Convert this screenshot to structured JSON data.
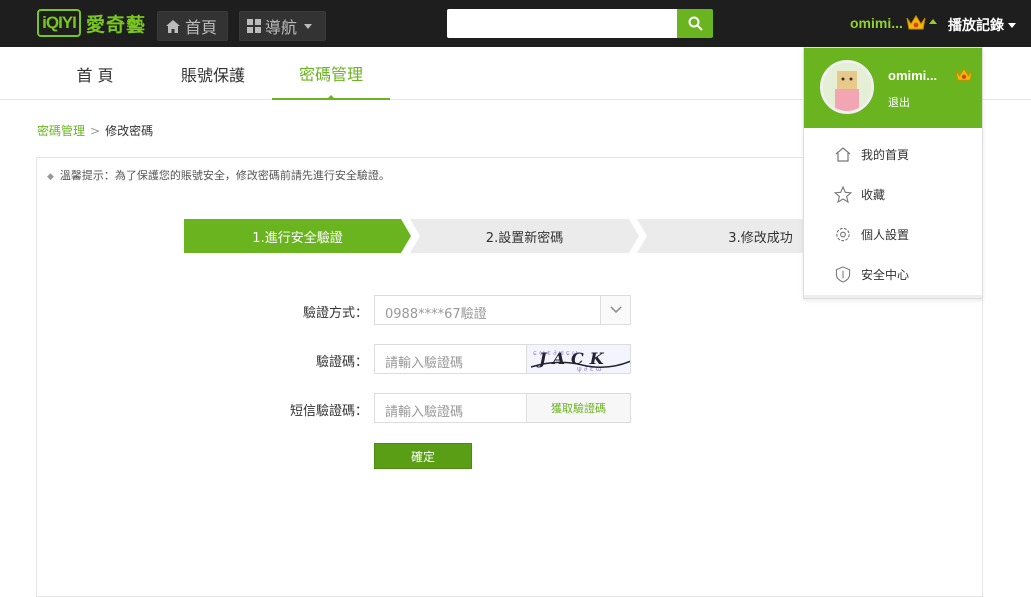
{
  "header": {
    "logo_mark": "iQIYI",
    "logo_text": "愛奇藝",
    "home_label": "首頁",
    "nav_label": "導航",
    "search_placeholder": "",
    "username": "omimi...",
    "history_label": "播放記錄",
    "accent_color": "#6ab41f"
  },
  "tabs": [
    {
      "label": "首 頁",
      "active": false
    },
    {
      "label": "賬號保護",
      "active": false
    },
    {
      "label": "密碼管理",
      "active": true
    }
  ],
  "breadcrumb": {
    "parent": "密碼管理",
    "separator": ">",
    "current": "修改密碼"
  },
  "tip": "溫馨提示：為了保護您的賬號安全，修改密碼前請先進行安全驗證。",
  "steps": [
    "1.進行安全驗證",
    "2.設置新密碼",
    "3.修改成功"
  ],
  "form": {
    "method_label": "驗證方式：",
    "method_value": "0988****67驗證",
    "captcha_label": "驗證碼：",
    "captcha_placeholder": "請輸入驗證碼",
    "captcha_text": "JACK",
    "sms_label": "短信驗證碼：",
    "sms_placeholder": "請輸入驗證碼",
    "sms_button": "獲取驗證碼",
    "submit": "確定"
  },
  "dropdown": {
    "name": "omimi...",
    "logout": "退出",
    "items": [
      {
        "label": "我的首頁",
        "icon": "home-icon"
      },
      {
        "label": "收藏",
        "icon": "star-icon"
      },
      {
        "label": "個人設置",
        "icon": "gear-icon"
      },
      {
        "label": "安全中心",
        "icon": "shield-icon"
      }
    ]
  }
}
